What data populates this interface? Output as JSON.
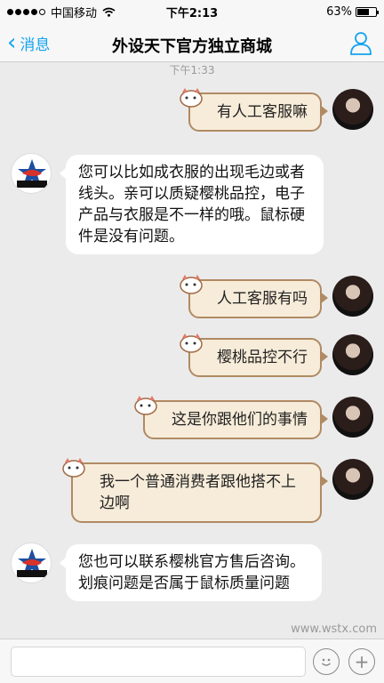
{
  "status_bar": {
    "carrier": "中国移动",
    "time": "下午2:13",
    "battery": "63%",
    "battery_level": 0.63
  },
  "nav": {
    "back_label": "消息",
    "title": "外设天下官方独立商城"
  },
  "chat": {
    "timestamp": "下午1:33",
    "messages": [
      {
        "from": "user",
        "text": "有人工客服嘛"
      },
      {
        "from": "shop",
        "text": "您可以比如成衣服的出现毛边或者线头。亲可以质疑樱桃品控，电子产品与衣服是不一样的哦。鼠标硬件是没有问题。"
      },
      {
        "from": "user",
        "text": "人工客服有吗"
      },
      {
        "from": "user",
        "text": "樱桃品控不行"
      },
      {
        "from": "user",
        "text": "这是你跟他们的事情"
      },
      {
        "from": "user",
        "text": "我一个普通消费者跟他搭不上边啊"
      },
      {
        "from": "shop",
        "text": "您也可以联系樱桃官方售后咨询。 划痕问题是否属于鼠标质量问题"
      }
    ]
  },
  "input": {
    "value": ""
  },
  "watermark": "www.wstx.com"
}
